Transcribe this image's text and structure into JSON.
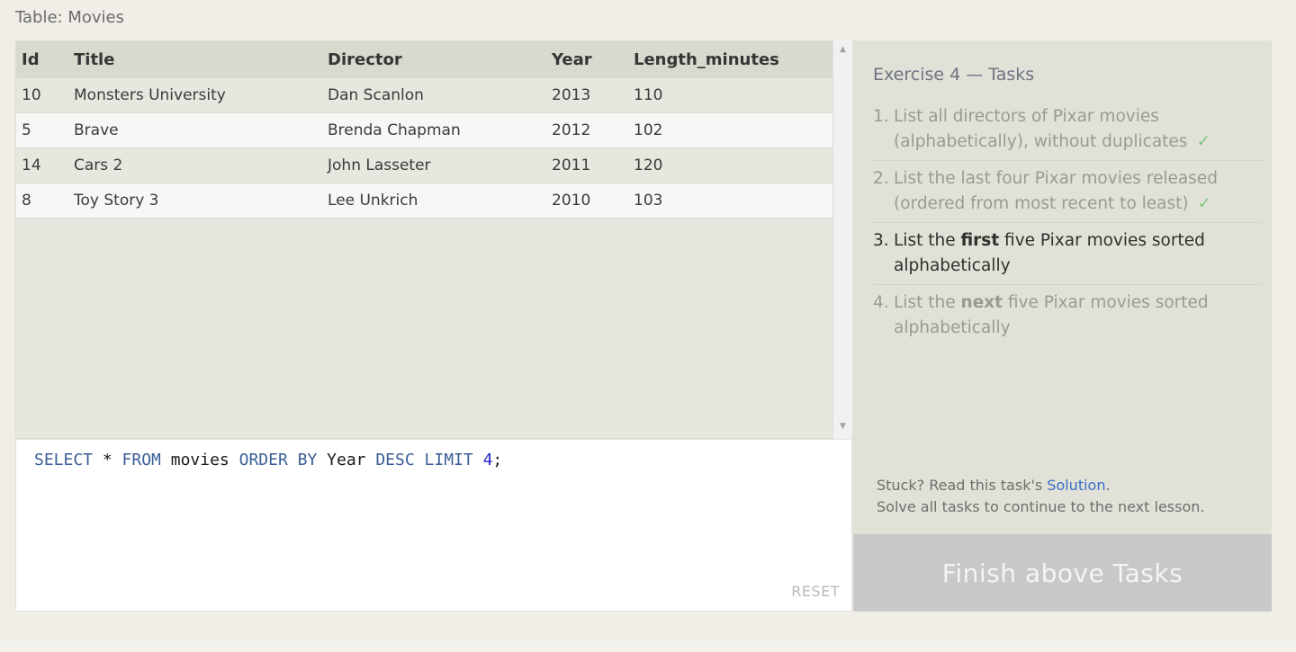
{
  "table_label": "Table: Movies",
  "results": {
    "headers": [
      "Id",
      "Title",
      "Director",
      "Year",
      "Length_minutes"
    ],
    "rows": [
      [
        "10",
        "Monsters University",
        "Dan Scanlon",
        "2013",
        "110"
      ],
      [
        "5",
        "Brave",
        "Brenda Chapman",
        "2012",
        "102"
      ],
      [
        "14",
        "Cars 2",
        "John Lasseter",
        "2011",
        "120"
      ],
      [
        "8",
        "Toy Story 3",
        "Lee Unkrich",
        "2010",
        "103"
      ]
    ]
  },
  "editor": {
    "tokens": {
      "t1": "SELECT",
      "t2": " * ",
      "t3": "FROM",
      "t4": " movies ",
      "t5": "ORDER BY",
      "t6": " Year ",
      "t7": "DESC",
      "t8": " ",
      "t9": "LIMIT",
      "t10": " ",
      "t11": "4",
      "t12": ";"
    },
    "reset_label": "RESET"
  },
  "tasks": {
    "title": "Exercise 4 — Tasks",
    "items": [
      {
        "num": "1.",
        "text": "List all directors of Pixar movies (alphabetically), without duplicates",
        "status": "done",
        "check": "✓"
      },
      {
        "num": "2.",
        "text": "List the last four Pixar movies released (ordered from most recent to least)",
        "status": "done",
        "check": "✓"
      },
      {
        "num": "3.",
        "pre": "List the ",
        "bold": "first",
        "post": " five Pixar movies sorted alphabetically",
        "status": "current"
      },
      {
        "num": "4.",
        "pre": "List the ",
        "bold": "next",
        "post": " five Pixar movies sorted alphabetically",
        "status": "pending"
      }
    ],
    "help": {
      "stuck_prefix": "Stuck? Read this task's ",
      "solution_link": "Solution",
      "stuck_suffix": ".",
      "continue_text": "Solve all tasks to continue to the next lesson."
    },
    "finish_label": "Finish above Tasks"
  },
  "colors": {
    "keyword": "#3b5e98",
    "number": "#2424c8",
    "link": "#3b6fc6",
    "check": "#7dc87d"
  }
}
